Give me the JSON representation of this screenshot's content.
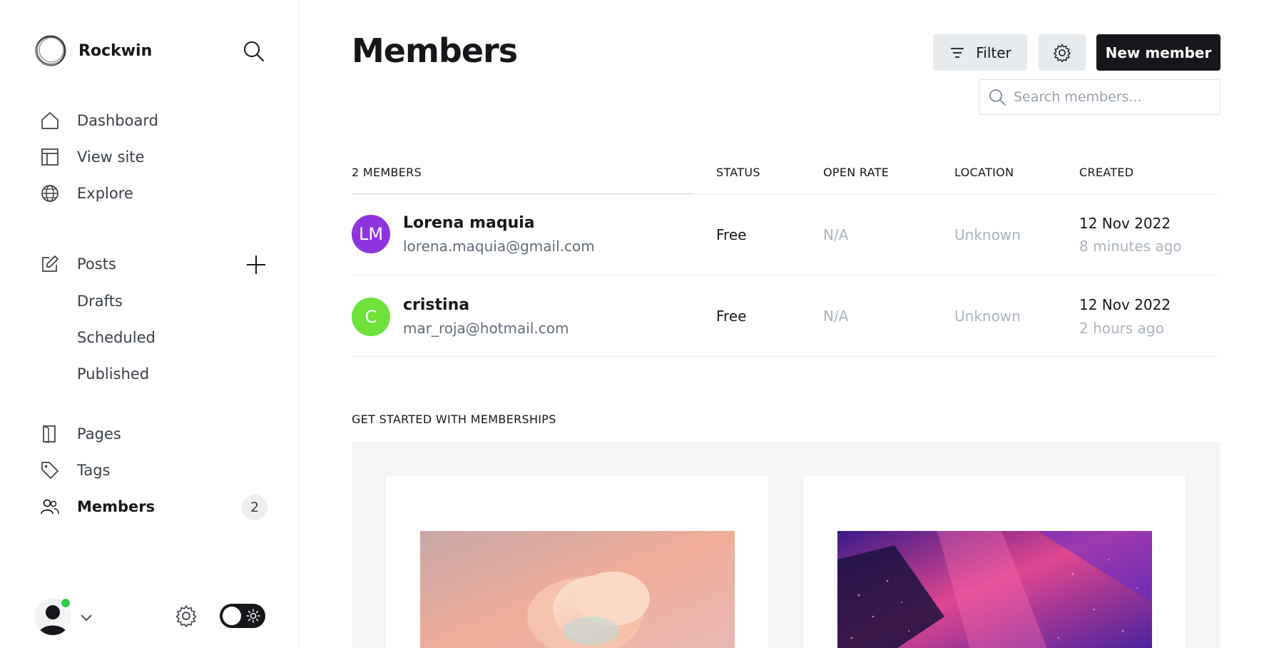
{
  "sidebar": {
    "brand": "Rockwin",
    "nav": {
      "dashboard": "Dashboard",
      "view_site": "View site",
      "explore": "Explore",
      "posts": "Posts",
      "drafts": "Drafts",
      "scheduled": "Scheduled",
      "published": "Published",
      "pages": "Pages",
      "tags": "Tags",
      "members": "Members"
    },
    "members_count": "2"
  },
  "header": {
    "title": "Members",
    "filter_label": "Filter",
    "new_member_label": "New member",
    "search_placeholder": "Search members..."
  },
  "table": {
    "headers": {
      "count": "2 MEMBERS",
      "status": "STATUS",
      "open_rate": "OPEN RATE",
      "location": "LOCATION",
      "created": "CREATED"
    },
    "rows": [
      {
        "initials": "LM",
        "avatar_color": "#8e35e0",
        "name": "Lorena maquia",
        "email": "lorena.maquia@gmail.com",
        "status": "Free",
        "open_rate": "N/A",
        "location": "Unknown",
        "created": "12 Nov 2022",
        "created_ago": "8 minutes ago"
      },
      {
        "initials": "C",
        "avatar_color": "#6ee13b",
        "name": "cristina",
        "email": "mar_roja@hotmail.com",
        "status": "Free",
        "open_rate": "N/A",
        "location": "Unknown",
        "created": "12 Nov 2022",
        "created_ago": "2 hours ago"
      }
    ]
  },
  "get_started": {
    "title": "GET STARTED WITH MEMBERSHIPS"
  },
  "colors": {
    "accent_dark": "#15171a",
    "online": "#30cf43"
  }
}
